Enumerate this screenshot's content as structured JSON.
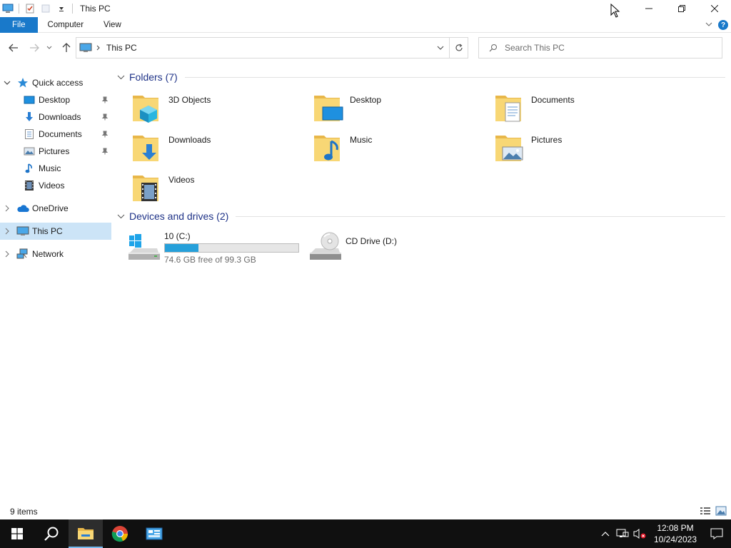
{
  "window": {
    "title": "This PC"
  },
  "ribbon": {
    "tabs": [
      "File",
      "Computer",
      "View"
    ]
  },
  "address": {
    "location": "This PC",
    "search_placeholder": "Search This PC"
  },
  "nav_pane": {
    "quick_access": "Quick access",
    "items": [
      "Desktop",
      "Downloads",
      "Documents",
      "Pictures",
      "Music",
      "Videos"
    ],
    "onedrive": "OneDrive",
    "this_pc": "This PC",
    "network": "Network"
  },
  "folders_group": {
    "header": "Folders (7)",
    "items": [
      "3D Objects",
      "Desktop",
      "Documents",
      "Downloads",
      "Music",
      "Pictures",
      "Videos"
    ]
  },
  "drives_group": {
    "header": "Devices and drives (2)",
    "drives": [
      {
        "name": "10 (C:)",
        "free_text": "74.6 GB free of 99.3 GB",
        "used_fraction": 0.249
      },
      {
        "name": "CD Drive (D:)"
      }
    ]
  },
  "status": {
    "item_count": "9 items"
  },
  "taskbar": {
    "time": "12:08 PM",
    "date": "10/24/2023"
  },
  "colors": {
    "accent": "#1979ca",
    "selection": "#cce4f7",
    "drive_bar": "#26a0da",
    "folder_yellow": "#f8d775",
    "taskbar": "#101010"
  }
}
